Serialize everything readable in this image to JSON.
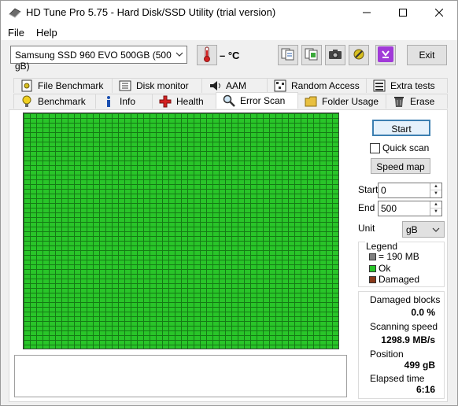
{
  "window": {
    "title": "HD Tune Pro 5.75 - Hard Disk/SSD Utility (trial version)",
    "minimize_glyph": "─",
    "maximize_glyph": "☐",
    "close_glyph": "✕"
  },
  "menu": {
    "file": "File",
    "help": "Help"
  },
  "toolbar": {
    "drive": "Samsung SSD 960 EVO 500GB (500 gB)",
    "temperature": "– °C",
    "exit_label": "Exit"
  },
  "tabs_top": [
    {
      "label": "File Benchmark"
    },
    {
      "label": "Disk monitor"
    },
    {
      "label": "AAM"
    },
    {
      "label": "Random Access"
    },
    {
      "label": "Extra tests"
    }
  ],
  "tabs_bottom": [
    {
      "label": "Benchmark"
    },
    {
      "label": "Info"
    },
    {
      "label": "Health"
    },
    {
      "label": "Error Scan"
    },
    {
      "label": "Folder Usage"
    },
    {
      "label": "Erase"
    }
  ],
  "active_tab": "Error Scan",
  "scan": {
    "start_label": "Start",
    "quick_scan_label": "Quick scan",
    "quick_scan_checked": false,
    "speed_map_label": "Speed map",
    "start_field_label": "Start",
    "start_value": "0",
    "end_field_label": "End",
    "end_value": "500",
    "unit_label": "Unit",
    "unit_value": "gB",
    "block_color": "#29c529"
  },
  "legend": {
    "title": "Legend",
    "items": [
      {
        "label": "= 190 MB",
        "color": "#808080"
      },
      {
        "label": "Ok",
        "color": "#29c529"
      },
      {
        "label": "Damaged",
        "color": "#8b3a1a"
      }
    ]
  },
  "stats": {
    "damaged_blocks_label": "Damaged blocks",
    "damaged_blocks_value": "0.0 %",
    "scanning_speed_label": "Scanning speed",
    "scanning_speed_value": "1298.9 MB/s",
    "position_label": "Position",
    "position_value": "499 gB",
    "elapsed_label": "Elapsed time",
    "elapsed_value": "6:16"
  }
}
